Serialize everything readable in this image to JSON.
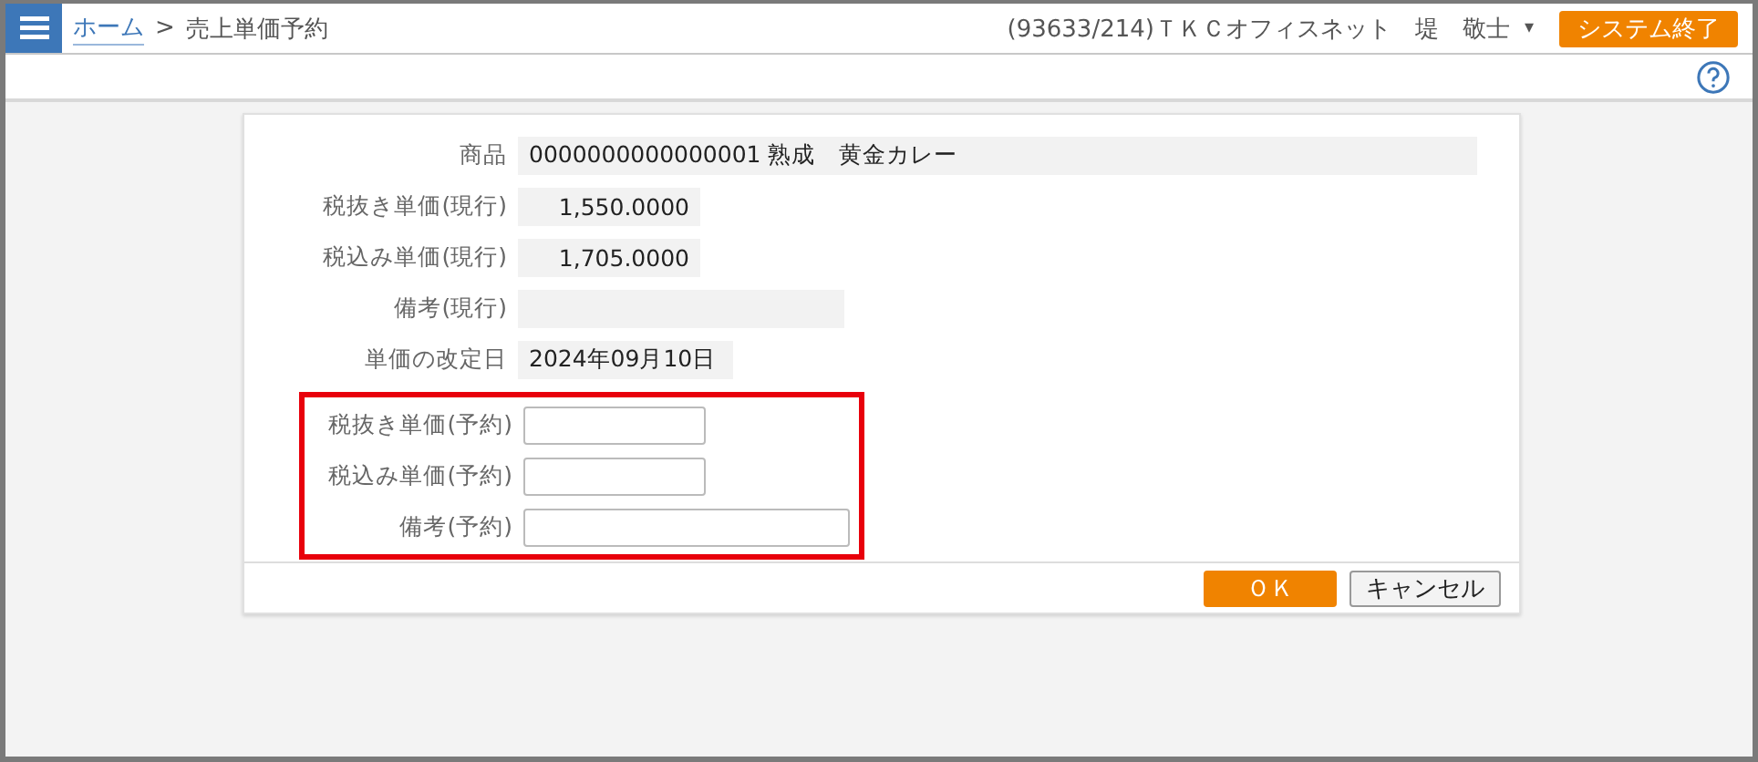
{
  "header": {
    "breadcrumb": [
      {
        "label": "ホーム",
        "kind": "link"
      },
      {
        "label": "売上単価予約",
        "kind": "current"
      }
    ],
    "separator": ">",
    "user": "(93633/214)ＴＫＣオフィスネット　堤　敬士",
    "user_menu": "▾",
    "exit_button": "システム終了"
  },
  "form": {
    "fields": [
      {
        "label": "商品",
        "kind": "text",
        "value": "0000000000000001 熟成　黄金カレー"
      },
      {
        "label": "税抜き単価(現行)",
        "kind": "number",
        "value": "1,550.0000"
      },
      {
        "label": "税込み単価(現行)",
        "kind": "number",
        "value": "1,705.0000"
      },
      {
        "label": "備考(現行)",
        "kind": "text"
      },
      {
        "label": "単価の改定日",
        "kind": "text",
        "value": "2024年09月10日"
      }
    ],
    "highlighted_fields": [
      {
        "label": "税抜き単価(予約)",
        "kind": "input"
      },
      {
        "label": "税込み単価(予約)",
        "kind": "input"
      },
      {
        "label": "備考(予約)",
        "kind": "input"
      }
    ],
    "buttons": [
      {
        "label": "ＯＫ",
        "kind": "primary"
      },
      {
        "label": "キャンセル",
        "kind": "secondary"
      }
    ]
  }
}
